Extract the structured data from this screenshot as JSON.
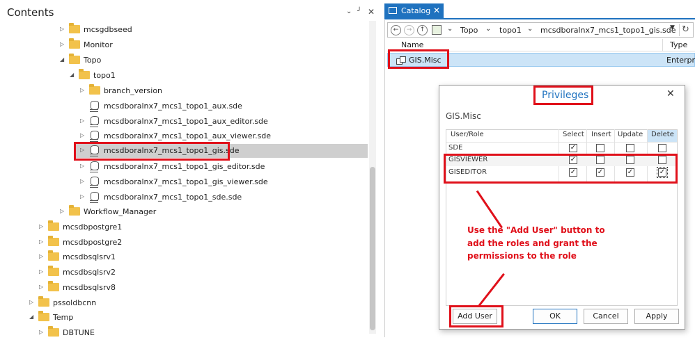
{
  "contents": {
    "title": "Contents",
    "pane_controls": [
      "chevron-down",
      "pin",
      "close"
    ],
    "tree": [
      {
        "label": "mcsgdbseed",
        "icon": "folder",
        "expanded": false
      },
      {
        "label": "Monitor",
        "icon": "folder",
        "expanded": false
      },
      {
        "label": "Topo",
        "icon": "folder",
        "expanded": true
      },
      {
        "label": "topo1",
        "icon": "folder",
        "expanded": true
      },
      {
        "label": "branch_version",
        "icon": "folder",
        "expanded": false
      },
      {
        "label": "mcsdboralnx7_mcs1_topo1_aux.sde",
        "icon": "database",
        "expanded": null
      },
      {
        "label": "mcsdboralnx7_mcs1_topo1_aux_editor.sde",
        "icon": "database",
        "expanded": false
      },
      {
        "label": "mcsdboralnx7_mcs1_topo1_aux_viewer.sde",
        "icon": "database",
        "expanded": false
      },
      {
        "label": "mcsdboralnx7_mcs1_topo1_gis.sde",
        "icon": "database",
        "expanded": false,
        "selected": true
      },
      {
        "label": "mcsdboralnx7_mcs1_topo1_gis_editor.sde",
        "icon": "database",
        "expanded": false
      },
      {
        "label": "mcsdboralnx7_mcs1_topo1_gis_viewer.sde",
        "icon": "database",
        "expanded": false
      },
      {
        "label": "mcsdboralnx7_mcs1_topo1_sde.sde",
        "icon": "database",
        "expanded": false
      },
      {
        "label": "Workflow_Manager",
        "icon": "folder",
        "expanded": false
      },
      {
        "label": "mcsdbpostgre1",
        "icon": "folder",
        "expanded": false
      },
      {
        "label": "mcsdbpostgre2",
        "icon": "folder",
        "expanded": false
      },
      {
        "label": "mcsdbsqlsrv1",
        "icon": "folder",
        "expanded": false
      },
      {
        "label": "mcsdbsqlsrv2",
        "icon": "folder",
        "expanded": false
      },
      {
        "label": "mcsdbsqlsrv8",
        "icon": "folder",
        "expanded": false
      },
      {
        "label": "pssoldbcnn",
        "icon": "folder",
        "expanded": false
      },
      {
        "label": "Temp",
        "icon": "folder",
        "expanded": true
      },
      {
        "label": "DBTUNE",
        "icon": "folder",
        "expanded": false
      }
    ]
  },
  "catalog": {
    "tab_label": "Catalog",
    "breadcrumbs": [
      "Topo",
      "topo1",
      "mcsdboralnx7_mcs1_topo1_gis.sde"
    ],
    "columns": {
      "name": "Name",
      "type": "Type"
    },
    "rows": [
      {
        "name": "GIS.Misc",
        "type": "Enterpris"
      }
    ]
  },
  "dialog": {
    "title": "Privileges",
    "object_name": "GIS.Misc",
    "headers": [
      "User/Role",
      "Select",
      "Insert",
      "Update",
      "Delete"
    ],
    "rows": [
      {
        "role": "SDE",
        "select": true,
        "insert": false,
        "update": false,
        "delete": false
      },
      {
        "role": "GISVIEWER",
        "select": true,
        "insert": false,
        "update": false,
        "delete": false
      },
      {
        "role": "GISEDITOR",
        "select": true,
        "insert": true,
        "update": true,
        "delete": true
      }
    ],
    "buttons": {
      "add_user": "Add User",
      "ok": "OK",
      "cancel": "Cancel",
      "apply": "Apply"
    }
  },
  "annotation": {
    "lines": [
      "Use the \"Add User\" button to",
      "add the roles and grant the",
      "permissions to the role"
    ],
    "color": "#e0101a"
  },
  "colors": {
    "accent": "#1f72bf",
    "selection": "#cce4f7",
    "highlight_box": "#e0101a",
    "folder": "#f2c24b"
  }
}
